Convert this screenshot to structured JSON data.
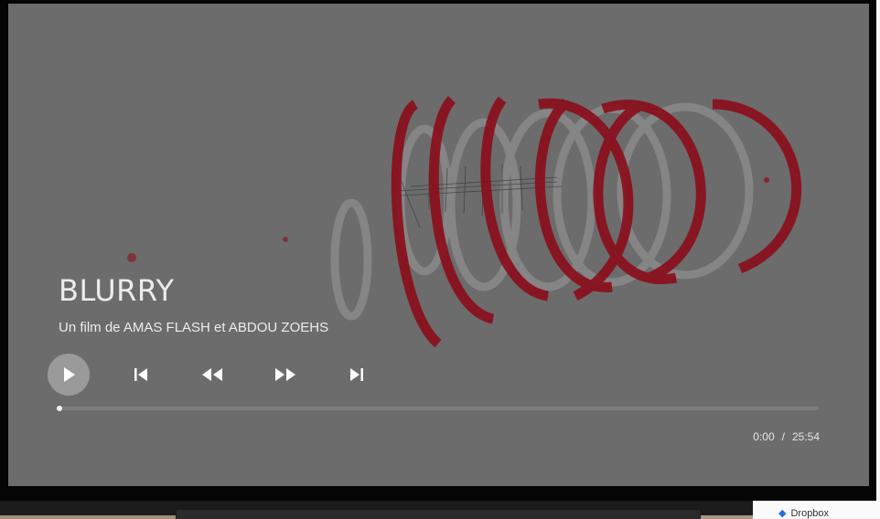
{
  "player": {
    "title": "BLURRY",
    "subtitle": "Un film de AMAS FLASH et ABDOU ZOEHS",
    "current_time": "0:00",
    "time_separator": "/",
    "duration": "25:54",
    "progress": 0.0,
    "controls": [
      "play",
      "previous",
      "rewind",
      "fast-forward",
      "next"
    ]
  },
  "background_page": {
    "dropbox_label": "Dropbox"
  },
  "colors": {
    "overlay": "#6c6c6c",
    "accent_red": "#8b0d1a",
    "text": "#ececec",
    "progress_track": "#7d7d7d",
    "progress_fill": "#f2f2f2"
  }
}
